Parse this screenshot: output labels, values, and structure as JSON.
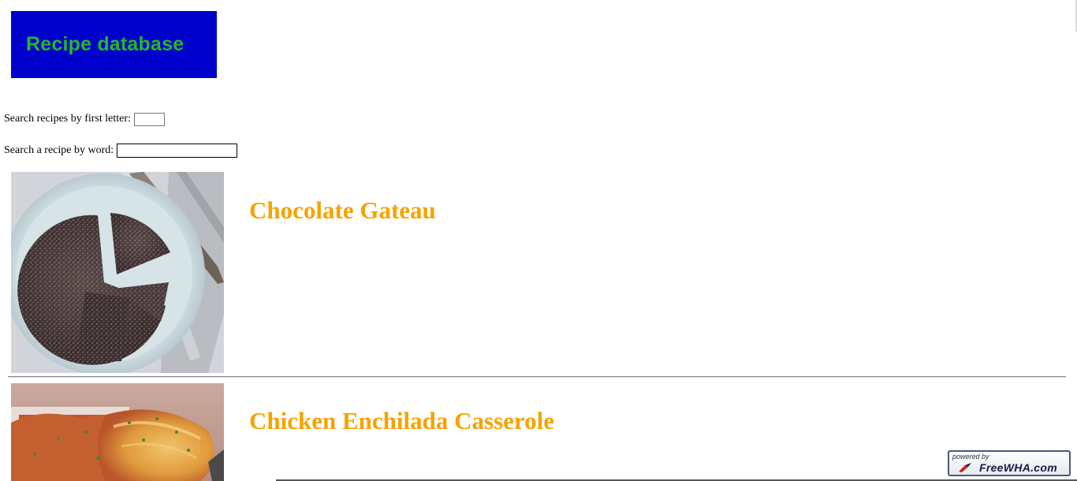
{
  "logo": {
    "text": "Recipe database"
  },
  "search": {
    "first_letter_label": "Search recipes by first letter:",
    "first_letter_value": "",
    "word_label": "Search a recipe by word:",
    "word_value": ""
  },
  "recipes": [
    {
      "title": "Chocolate Gateau",
      "image": "chocolate-cake-photo"
    },
    {
      "title": "Chicken Enchilada Casserole",
      "image": "enchilada-casserole-photo"
    }
  ],
  "badge": {
    "small_text": "powered by",
    "brand_text": "FreeWHA.com"
  },
  "colors": {
    "logo_background": "#0000cc",
    "logo_text": "#22bb22",
    "recipe_title": "#f5a300"
  }
}
